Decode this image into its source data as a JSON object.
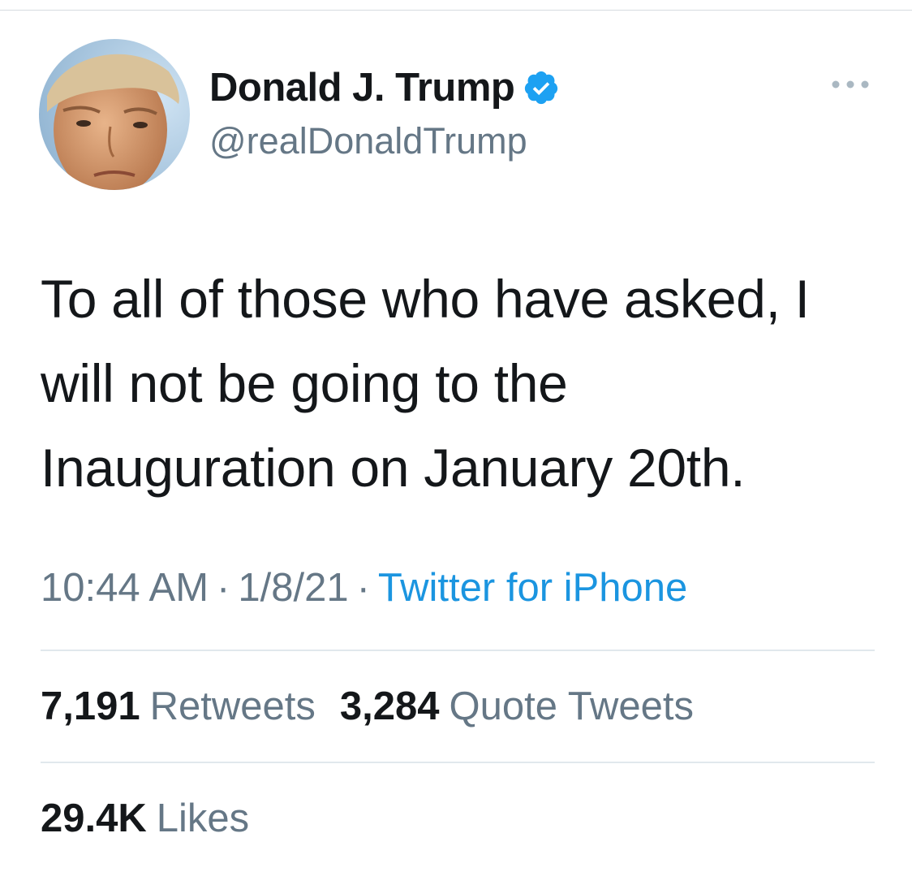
{
  "colors": {
    "text_primary": "#14171a",
    "text_secondary": "#657786",
    "link": "#1b95e0",
    "verified": "#1da1f2"
  },
  "author": {
    "display_name": "Donald J. Trump",
    "handle": "@realDonaldTrump",
    "verified_icon": "verified-badge-icon",
    "avatar_icon": "profile-photo"
  },
  "more_icon": "ellipsis-icon",
  "tweet": {
    "text_line_1": "To all of those who have asked, I",
    "text_line_2": "will not be going to the",
    "text_line_3": "Inauguration on January 20th."
  },
  "meta": {
    "time": "10:44 AM",
    "separator": "·",
    "date": "1/8/21",
    "source": "Twitter for iPhone"
  },
  "stats": {
    "retweets_count": "7,191",
    "retweets_label": "Retweets",
    "quotes_count": "3,284",
    "quotes_label": "Quote Tweets",
    "likes_count": "29.4K",
    "likes_label": "Likes"
  }
}
